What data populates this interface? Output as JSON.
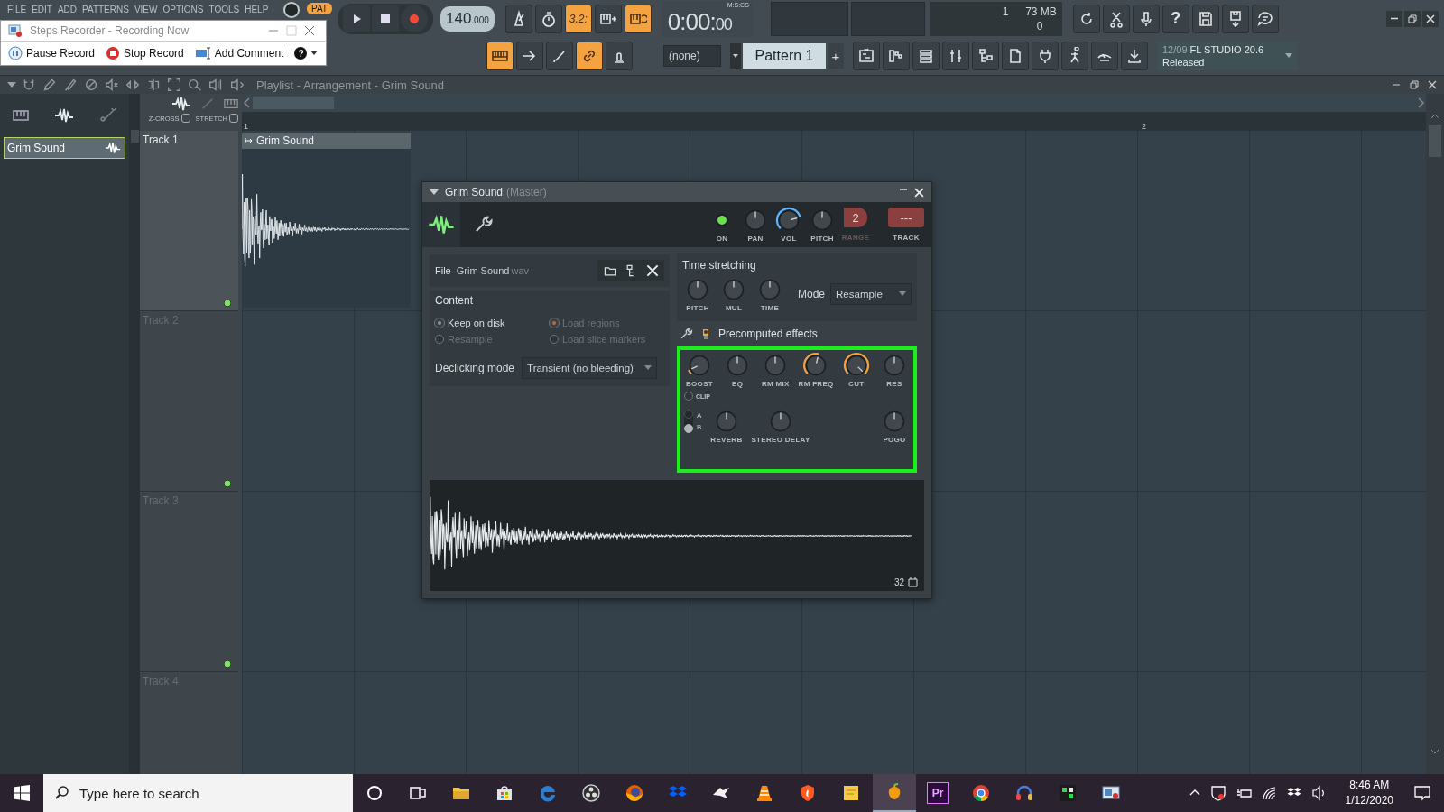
{
  "menu": [
    "FILE",
    "EDIT",
    "ADD",
    "PATTERNS",
    "VIEW",
    "OPTIONS",
    "TOOLS",
    "HELP"
  ],
  "transport": {
    "pat_label": "PAT",
    "pat_on": true,
    "tempo": "140",
    "tempo_fraction": ".000"
  },
  "toggles": [
    {
      "kind": "metronome",
      "on": false
    },
    {
      "kind": "stopwatch",
      "on": false
    },
    {
      "kind": "countdown",
      "label": "3.2:",
      "on": true
    },
    {
      "kind": "step",
      "on": false
    },
    {
      "kind": "loop",
      "on": true
    }
  ],
  "time": {
    "unit": "M:S:CS",
    "value": "0:00:",
    "cs": "00"
  },
  "monitor": {
    "voices": "1",
    "memory": "73 MB",
    "cpu": "0"
  },
  "global_buttons": [
    {
      "kind": "undo"
    },
    {
      "kind": "scissors"
    },
    {
      "kind": "microphone"
    },
    {
      "kind": "help",
      "label": "?"
    },
    {
      "kind": "save"
    },
    {
      "kind": "export"
    },
    {
      "kind": "chat"
    }
  ],
  "row2_toggles": [
    {
      "kind": "keyboard",
      "on": true
    },
    {
      "kind": "arrow",
      "on": false
    },
    {
      "kind": "brush",
      "on": false
    },
    {
      "kind": "link",
      "on": true
    },
    {
      "kind": "stamp",
      "on": false
    }
  ],
  "channel_select": "(none)",
  "pattern": {
    "name": "Pattern 1",
    "add": "+"
  },
  "view_buttons": [
    {
      "kind": "playlist"
    },
    {
      "kind": "steps"
    },
    {
      "kind": "rack"
    },
    {
      "kind": "mixer"
    },
    {
      "kind": "tree"
    },
    {
      "kind": "document"
    },
    {
      "kind": "plug"
    },
    {
      "kind": "figure"
    },
    {
      "kind": "hand"
    },
    {
      "kind": "download"
    }
  ],
  "news": {
    "date": "12/09",
    "title": "FL STUDIO 20.6",
    "status": "Released"
  },
  "steps_recorder": {
    "title": "Steps Recorder - Recording Now",
    "buttons": [
      {
        "kind": "pause",
        "label": "Pause Record"
      },
      {
        "kind": "stop",
        "label": "Stop Record"
      },
      {
        "kind": "comment",
        "label": "Add Comment"
      },
      {
        "kind": "help",
        "label": "?"
      }
    ]
  },
  "playlist": {
    "tools": [
      {
        "kind": "magnet"
      },
      {
        "kind": "pencil"
      },
      {
        "kind": "paint"
      },
      {
        "kind": "ban"
      },
      {
        "kind": "mute"
      },
      {
        "kind": "slip"
      },
      {
        "kind": "slice"
      },
      {
        "kind": "select"
      },
      {
        "kind": "zoom"
      },
      {
        "kind": "speaker"
      }
    ],
    "title": "Playlist - Arrangement - Grim Sound",
    "snap_options": [
      {
        "label": "Z-CROSS",
        "checked": false
      },
      {
        "label": "STRETCH",
        "checked": false
      }
    ],
    "ruler": [
      "1",
      "2"
    ],
    "tracks": [
      {
        "name": "Track 1",
        "selected": true
      },
      {
        "name": "Track 2",
        "selected": false
      },
      {
        "name": "Track 3",
        "selected": false
      },
      {
        "name": "Track 4",
        "selected": false
      }
    ],
    "clip": {
      "name": "Grim Sound"
    }
  },
  "browser": {
    "items": [
      {
        "name": "Grim Sound",
        "selected": true
      }
    ]
  },
  "plugin": {
    "title": "Grim Sound",
    "subtitle": "(Master)",
    "on": true,
    "header_knobs": [
      {
        "label": "PAN"
      },
      {
        "label": "VOL",
        "level": 0.78,
        "color": "#5fb4ff"
      },
      {
        "label": "PITCH"
      }
    ],
    "range": {
      "label": "RANGE",
      "value": "2"
    },
    "track": {
      "label": "TRACK",
      "value": "---"
    },
    "on_label": "ON",
    "file": {
      "label": "File",
      "name": "Grim Sound",
      "ext": "wav"
    },
    "content": {
      "title": "Content",
      "options": [
        {
          "label": "Keep on disk",
          "selected": true,
          "disabled": false
        },
        {
          "label": "Load regions",
          "selected": true,
          "disabled": true
        },
        {
          "label": "Resample",
          "selected": false,
          "disabled": true
        },
        {
          "label": "Load slice markers",
          "selected": false,
          "disabled": true
        }
      ],
      "declicking_label": "Declicking mode",
      "declicking_value": "Transient (no bleeding)"
    },
    "time_stretching": {
      "title": "Time stretching",
      "knobs": [
        {
          "label": "PITCH"
        },
        {
          "label": "MUL"
        },
        {
          "label": "TIME"
        }
      ],
      "mode_label": "Mode",
      "mode_value": "Resample"
    },
    "effects": {
      "title": "Precomputed effects",
      "knobs": [
        {
          "label": "BOOST",
          "level": 0.08,
          "color": "#f5a341"
        },
        {
          "label": "EQ"
        },
        {
          "label": "RM MIX"
        },
        {
          "label": "RM FREQ",
          "level": 0.55,
          "color": "#f5a341"
        },
        {
          "label": "CUT",
          "level": 1.0,
          "color": "#f5a341"
        },
        {
          "label": "RES"
        }
      ],
      "clip": {
        "label": "CLIP",
        "checked": false
      },
      "ab": [
        {
          "label": "A",
          "selected": false
        },
        {
          "label": "B",
          "selected": true
        }
      ],
      "knobs2": [
        {
          "label": "REVERB"
        },
        {
          "label": "STEREO DELAY"
        },
        {
          "label": "POGO"
        }
      ]
    },
    "zoom_label": "32"
  },
  "taskbar": {
    "search_placeholder": "Type here to search",
    "apps": [
      {
        "kind": "cortana",
        "active": false
      },
      {
        "kind": "taskview",
        "active": false
      },
      {
        "kind": "folder",
        "active": false
      },
      {
        "kind": "store",
        "active": false
      },
      {
        "kind": "edge",
        "active": false
      },
      {
        "kind": "obs",
        "active": false
      },
      {
        "kind": "firefox",
        "active": false
      },
      {
        "kind": "dropbox",
        "active": false
      },
      {
        "kind": "bird",
        "active": false
      },
      {
        "kind": "vlc",
        "active": false
      },
      {
        "kind": "shield",
        "active": false
      },
      {
        "kind": "notes",
        "active": false
      },
      {
        "kind": "fruit",
        "active": true
      },
      {
        "kind": "premiere",
        "label": "Pr",
        "active": false
      },
      {
        "kind": "chrome",
        "active": false
      },
      {
        "kind": "headset",
        "active": false
      },
      {
        "kind": "green",
        "active": false
      },
      {
        "kind": "recorder",
        "active": false
      }
    ],
    "time": "8:46 AM",
    "date": "1/12/2020"
  }
}
